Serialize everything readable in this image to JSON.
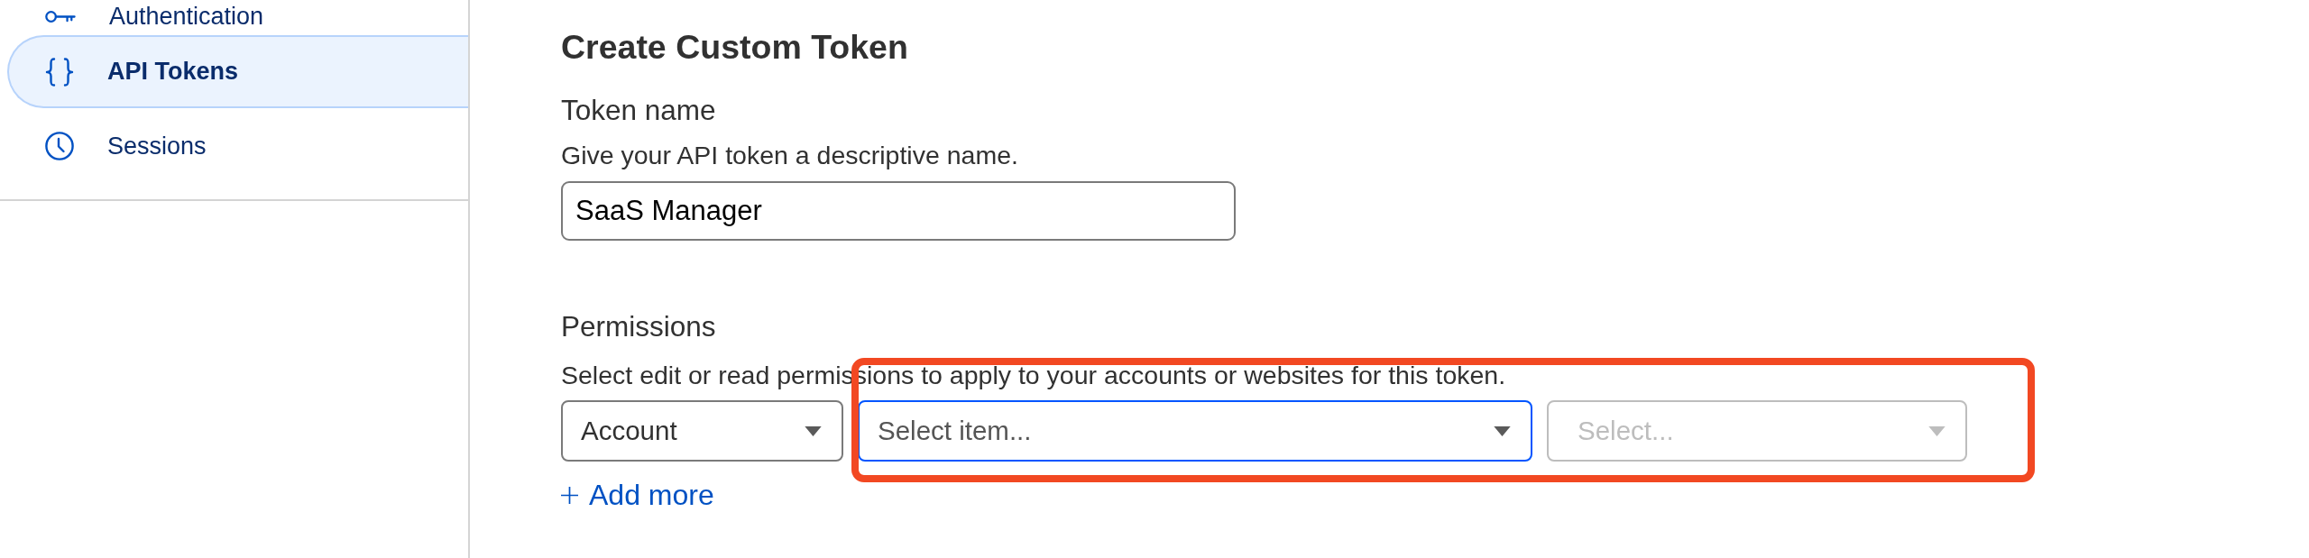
{
  "sidebar": {
    "items": [
      {
        "label": "Authentication",
        "selected": false
      },
      {
        "label": "API Tokens",
        "selected": true
      },
      {
        "label": "Sessions",
        "selected": false
      }
    ]
  },
  "page": {
    "title": "Create Custom Token"
  },
  "token_name": {
    "label": "Token name",
    "description": "Give your API token a descriptive name.",
    "value": "SaaS Manager"
  },
  "permissions": {
    "label": "Permissions",
    "description": "Select edit or read permissions to apply to your accounts or websites for this token.",
    "selects": [
      {
        "value": "Account",
        "focused": false,
        "disabled": false
      },
      {
        "placeholder": "Select item...",
        "focused": true,
        "disabled": false
      },
      {
        "placeholder": "Select...",
        "focused": false,
        "disabled": true
      }
    ],
    "add_link": "Add more",
    "highlight_frame": true
  }
}
